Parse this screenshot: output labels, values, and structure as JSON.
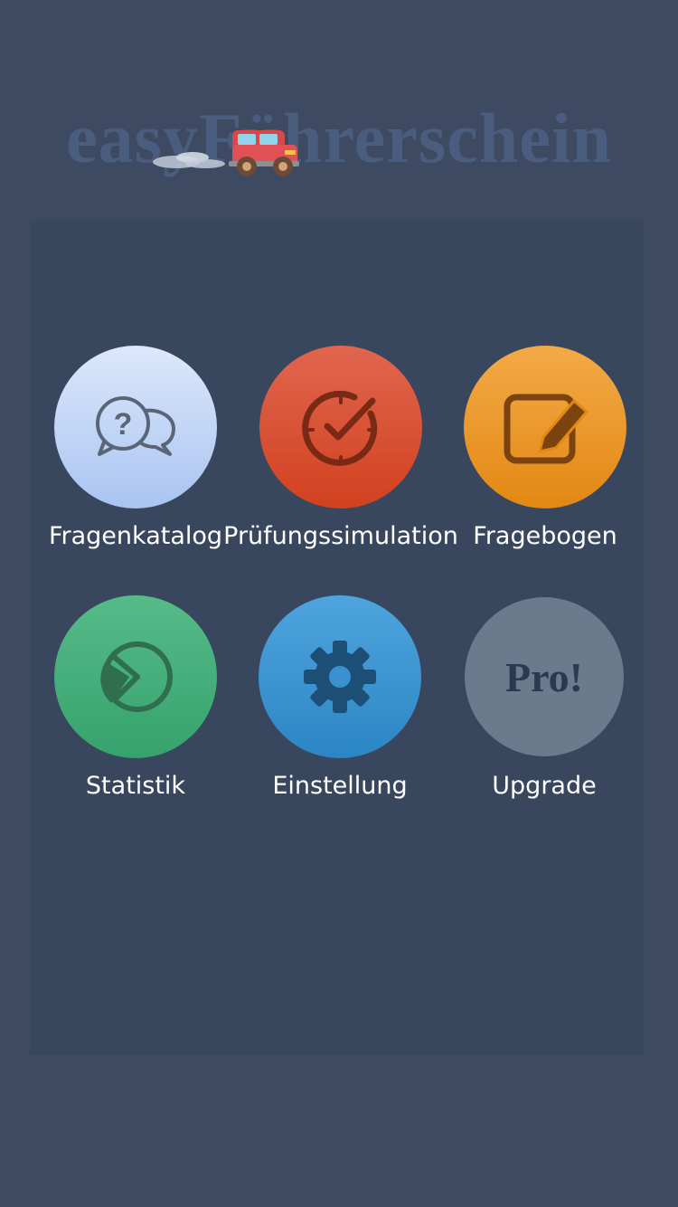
{
  "app": {
    "logo_text": "easyFührerschein",
    "logo_icon": "car-icon"
  },
  "menu": {
    "items": [
      {
        "label": "Fragenkatalog",
        "icon": "question-chat-icon",
        "color": "#c3d6f6"
      },
      {
        "label": "Prüfungssimulation",
        "icon": "clock-check-icon",
        "color": "#d9532f"
      },
      {
        "label": "Fragebogen",
        "icon": "edit-icon",
        "color": "#eb9a2c"
      },
      {
        "label": "Statistik",
        "icon": "pie-chart-icon",
        "color": "#45ae7a"
      },
      {
        "label": "Einstellung",
        "icon": "gear-icon",
        "color": "#3c95d1"
      },
      {
        "label": "Upgrade",
        "icon": "pro-badge-icon",
        "icon_text": "Pro!",
        "color": "#6b7a8c"
      }
    ]
  },
  "colors": {
    "background": "#3d4a62",
    "panel": "#38465e"
  }
}
